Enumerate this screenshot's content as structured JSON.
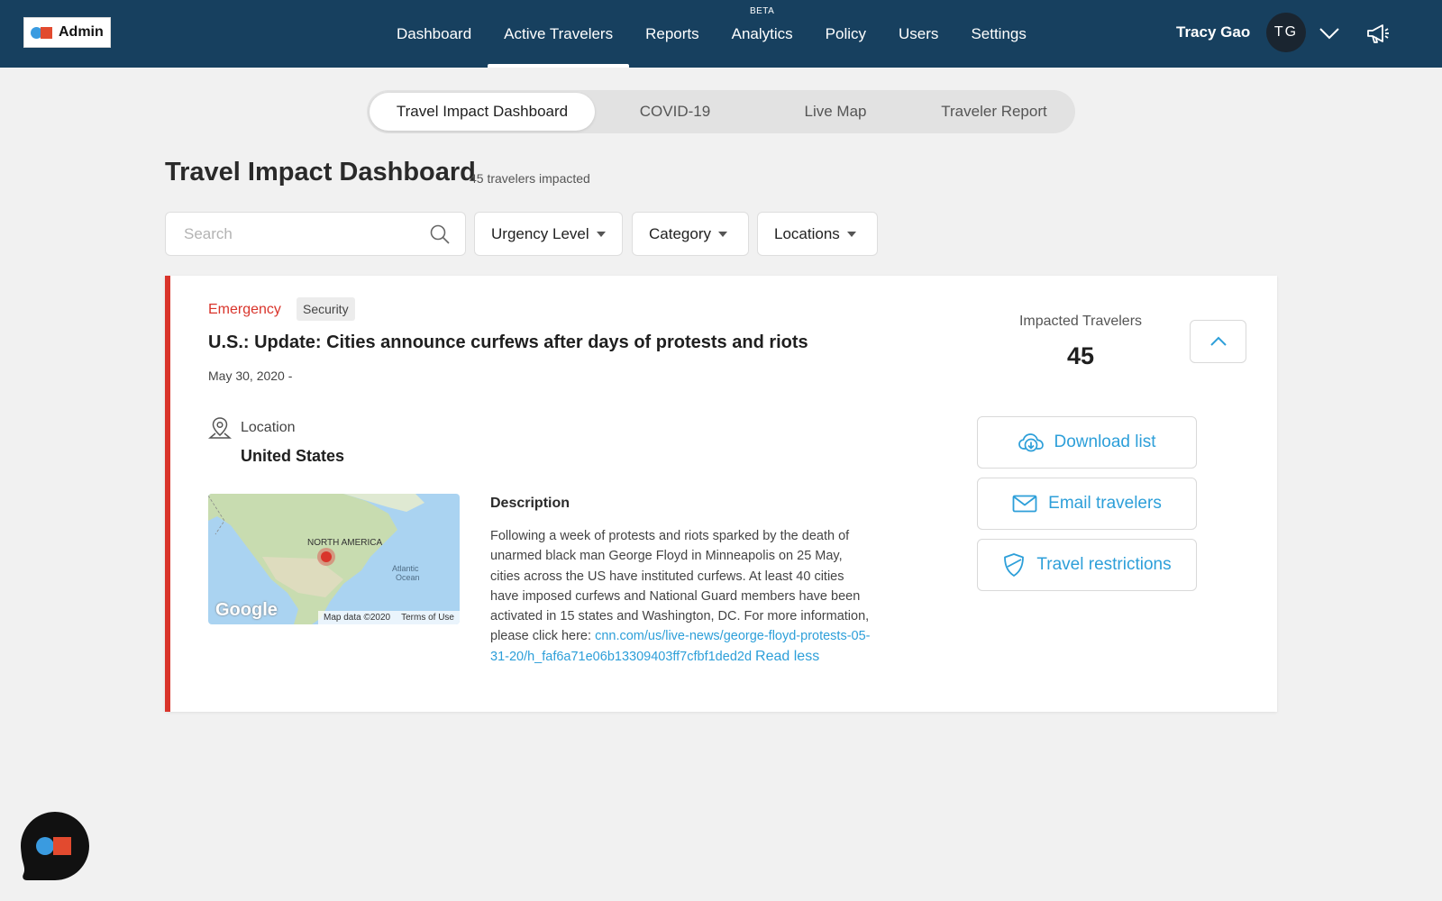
{
  "app": {
    "logo_label": "Admin",
    "brand_colors": {
      "navy": "#17405f",
      "blue": "#3a9be0",
      "red": "#e24a2f"
    }
  },
  "nav": {
    "items": [
      {
        "label": "Dashboard",
        "active": false
      },
      {
        "label": "Active Travelers",
        "active": true
      },
      {
        "label": "Reports",
        "active": false
      },
      {
        "label": "Analytics",
        "active": false,
        "badge": "BETA"
      },
      {
        "label": "Policy",
        "active": false
      },
      {
        "label": "Users",
        "active": false
      },
      {
        "label": "Settings",
        "active": false
      }
    ]
  },
  "user": {
    "name": "Tracy Gao",
    "initials": "TG",
    "menu_icon": "chevron-down-icon",
    "announcements_icon": "megaphone-icon"
  },
  "tabs": [
    {
      "label": "Travel Impact Dashboard",
      "active": true
    },
    {
      "label": "COVID-19",
      "active": false
    },
    {
      "label": "Live Map",
      "active": false
    },
    {
      "label": "Traveler Report",
      "active": false
    }
  ],
  "page": {
    "title": "Travel Impact Dashboard",
    "subtitle": "45 travelers impacted"
  },
  "filters": {
    "search_placeholder": "Search",
    "search_value": "",
    "dropdowns": [
      "Urgency Level",
      "Category",
      "Locations"
    ]
  },
  "alert": {
    "urgency": "Emergency",
    "urgency_color": "#d9342b",
    "category": "Security",
    "title": "U.S.: Update: Cities announce curfews after days of protests and riots",
    "date": "May 30, 2020 -",
    "location_label": "Location",
    "location_value": "United States",
    "map": {
      "region_label": "NORTH AMERICA",
      "ocean_label_1": "Atlantic",
      "ocean_label_2": "Ocean",
      "attribution": "Google",
      "map_data": "Map data ©2020",
      "terms": "Terms of Use"
    },
    "description_heading": "Description",
    "description_text": "Following a week of protests and riots sparked by the death of unarmed black man George Floyd in Minneapolis on 25 May, cities across the US have instituted curfews. At least 40 cities have imposed curfews and National Guard members have been activated in 15 states and Washington, DC. For more information, please click here: ",
    "description_link": "cnn.com/us/live-news/george-floyd-protests-05-31-20/h_faf6a71e06b13309403ff7cfbf1ded2d",
    "read_less": "Read less",
    "impacted_label": "Impacted Travelers",
    "impacted_count": "45",
    "actions": {
      "download": "Download list",
      "email": "Email travelers",
      "restrictions": "Travel restrictions"
    }
  }
}
